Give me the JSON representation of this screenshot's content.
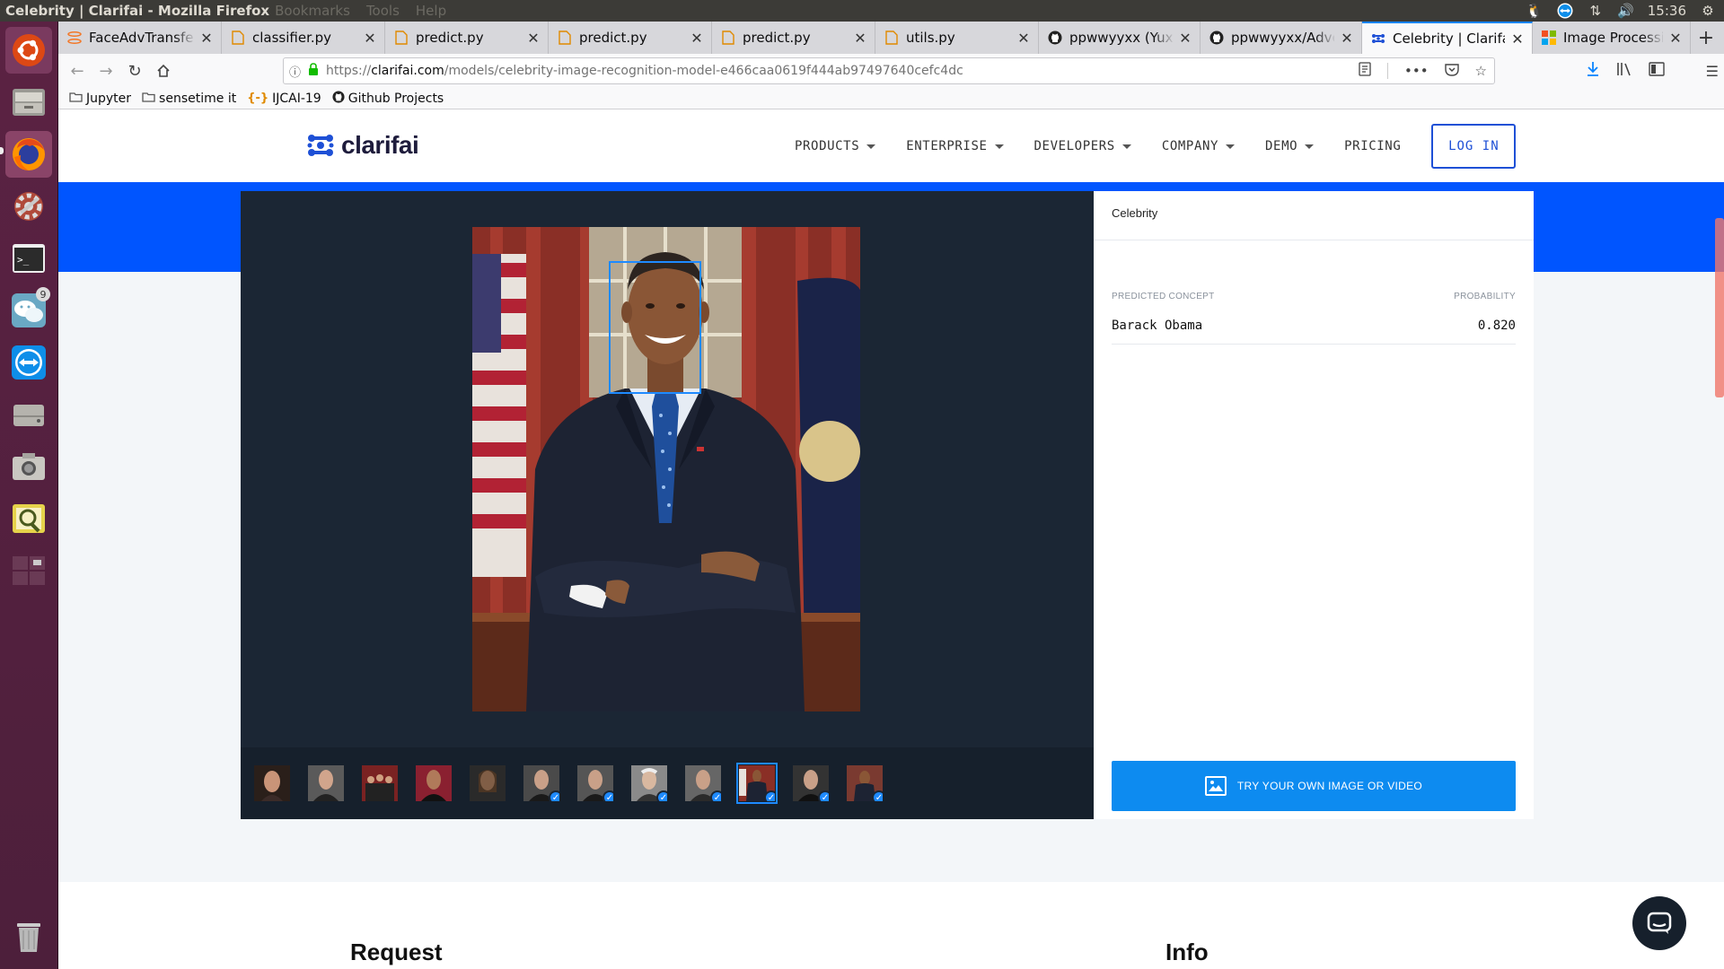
{
  "window": {
    "title": "Celebrity | Clarifai - Mozilla Firefox",
    "menu_ghost": [
      "Bookmarks",
      "Tools",
      "Help"
    ],
    "clock": "15:36"
  },
  "launcher": {
    "items": [
      "ubuntu-dash",
      "files",
      "firefox",
      "settings",
      "terminal",
      "wechat",
      "teamviewer",
      "disk",
      "camera",
      "image-viewer",
      "workspaces",
      "trash"
    ],
    "wechat_badge": "9"
  },
  "tabs": [
    {
      "label": "FaceAdvTransfer/",
      "icon": "jupyter-icon"
    },
    {
      "label": "classifier.py",
      "icon": "file-icon"
    },
    {
      "label": "predict.py",
      "icon": "file-icon"
    },
    {
      "label": "predict.py",
      "icon": "file-icon"
    },
    {
      "label": "predict.py",
      "icon": "file-icon"
    },
    {
      "label": "utils.py",
      "icon": "file-icon"
    },
    {
      "label": "ppwwyyxx (Yuxin",
      "icon": "github-icon"
    },
    {
      "label": "ppwwyyxx/Adver",
      "icon": "github-icon"
    },
    {
      "label": "Celebrity | Clarifai",
      "icon": "clarifai-icon",
      "active": true
    },
    {
      "label": "Image Processing",
      "icon": "windows-icon"
    }
  ],
  "urlbar": {
    "prefix": "https://",
    "domain": "clarifai.com",
    "path": "/models/celebrity-image-recognition-model-e466caa0619f444ab97497640cefc4dc"
  },
  "bookmarks": [
    {
      "label": "Jupyter",
      "icon": "folder-icon"
    },
    {
      "label": "sensetime it",
      "icon": "folder-icon"
    },
    {
      "label": "IJCAI-19",
      "icon": "ijcai-icon"
    },
    {
      "label": "Github Projects",
      "icon": "github-icon"
    }
  ],
  "site": {
    "logo": "clarifai",
    "nav": [
      {
        "label": "PRODUCTS",
        "dropdown": true
      },
      {
        "label": "ENTERPRISE",
        "dropdown": true
      },
      {
        "label": "DEVELOPERS",
        "dropdown": true
      },
      {
        "label": "COMPANY",
        "dropdown": true
      },
      {
        "label": "DEMO",
        "dropdown": true
      },
      {
        "label": "PRICING",
        "dropdown": false
      }
    ],
    "login": "LOG IN",
    "brand_blue": "#0055ff"
  },
  "demo": {
    "model_name": "Celebrity",
    "col_concept": "PREDICTED CONCEPT",
    "col_probability": "PROBABILITY",
    "predictions": [
      {
        "concept": "Barack Obama",
        "probability": "0.820"
      }
    ],
    "try_button": "TRY YOUR OWN IMAGE OR VIDEO",
    "thumbnails": 12,
    "selected_thumbnail": 10
  },
  "lower": {
    "left_heading": "Request",
    "right_heading": "Info"
  }
}
